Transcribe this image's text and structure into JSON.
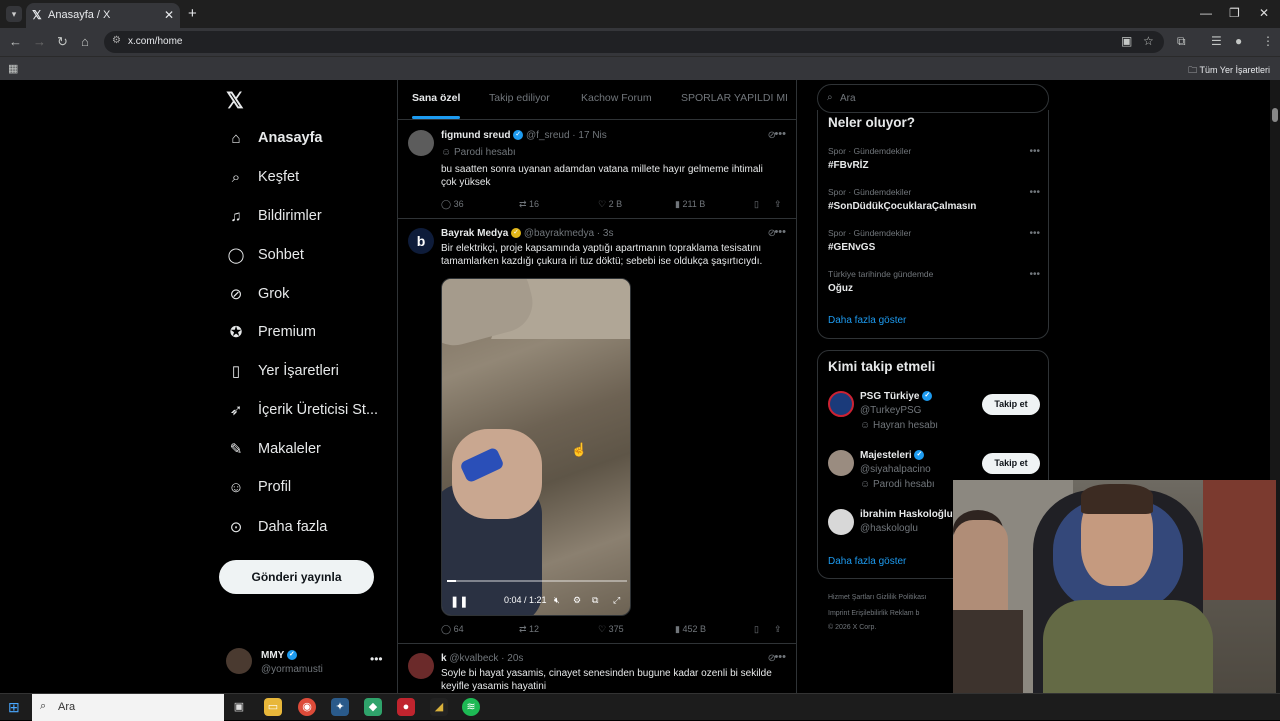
{
  "browser": {
    "tab_title": "Anasayfa / X",
    "url": "x.com/home",
    "all_bookmarks": "Tüm Yer İşaretleri"
  },
  "sidebar": {
    "items": [
      {
        "label": "Anasayfa",
        "icon": "home-icon"
      },
      {
        "label": "Keşfet",
        "icon": "search-icon"
      },
      {
        "label": "Bildirimler",
        "icon": "bell-icon"
      },
      {
        "label": "Sohbet",
        "icon": "chat-icon"
      },
      {
        "label": "Grok",
        "icon": "grok-icon"
      },
      {
        "label": "Premium",
        "icon": "premium-icon"
      },
      {
        "label": "Yer İşaretleri",
        "icon": "bookmark-icon"
      },
      {
        "label": "İçerik Üreticisi St...",
        "icon": "rocket-icon"
      },
      {
        "label": "Makaleler",
        "icon": "article-icon"
      },
      {
        "label": "Profil",
        "icon": "person-icon"
      },
      {
        "label": "Daha fazla",
        "icon": "more-circle-icon"
      }
    ],
    "post_button": "Gönderi yayınla",
    "account": {
      "name": "MMY",
      "handle": "@yormamusti"
    }
  },
  "feed": {
    "tabs": [
      "Sana özel",
      "Takip ediliyor",
      "Kachow Forum",
      "SPORLAR YAPILDI MI"
    ],
    "tweets": [
      {
        "name": "figmund sreud",
        "handle": "@f_sreud",
        "time": "17 Nis",
        "badge": "Parodi hesabı",
        "text": "bu saatten sonra uyanan adamdan vatana millete hayır gelmeme ihtimali çok yüksek",
        "replies": "36",
        "retweets": "16",
        "likes": "2 B",
        "views": "211 B"
      },
      {
        "name": "Bayrak Medya",
        "handle": "@bayrakmedya",
        "time": "3s",
        "text": "Bir elektrikçi, proje kapsamında yaptığı apartmanın topraklama tesisatını tamamlarken kazdığı çukura iri tuz döktü; sebebi ise oldukça şaşırtıcıydı.",
        "video_time": "0:04 / 1:21",
        "video_progress": 0.05,
        "replies": "64",
        "retweets": "12",
        "likes": "375",
        "views": "452 B"
      },
      {
        "name": "k",
        "handle": "@kvalbeck",
        "time": "20s",
        "text": "Soyle bi hayat yasamis, cinayet senesinden bugune kadar ozenli bi sekilde keyifle yasamis hayatini"
      }
    ]
  },
  "right": {
    "search_placeholder": "Ara",
    "trends_title": "Neler oluyor?",
    "trends": [
      {
        "category": "Spor · Gündemdekiler",
        "name": "#FBvRİZ"
      },
      {
        "category": "Spor · Gündemdekiler",
        "name": "#SonDüdükÇocuklaraÇalmasın"
      },
      {
        "category": "Spor · Gündemdekiler",
        "name": "#GENvGS"
      },
      {
        "category": "Türkiye tarihinde gündemde",
        "name": "Oğuz"
      }
    ],
    "show_more": "Daha fazla göster",
    "who_title": "Kimi takip etmeli",
    "who": [
      {
        "name": "PSG Türkiye",
        "handle": "@TurkeyPSG",
        "badge": "Hayran hesabı",
        "button": "Takip et"
      },
      {
        "name": "Majesteleri",
        "handle": "@siyahalpacino",
        "badge": "Parodi hesabı",
        "button": "Takip et"
      },
      {
        "name": "ibrahim Haskoloğlu",
        "handle": "@haskologlu"
      }
    ],
    "who_more": "Daha fazla göster",
    "footer_1": "Hizmet Şartları   Gizlilik Politikası",
    "footer_2": "Imprint   Erişilebilirlik   Reklam b",
    "footer_3": "© 2026 X Corp."
  },
  "taskbar": {
    "search_placeholder": "Ara"
  }
}
